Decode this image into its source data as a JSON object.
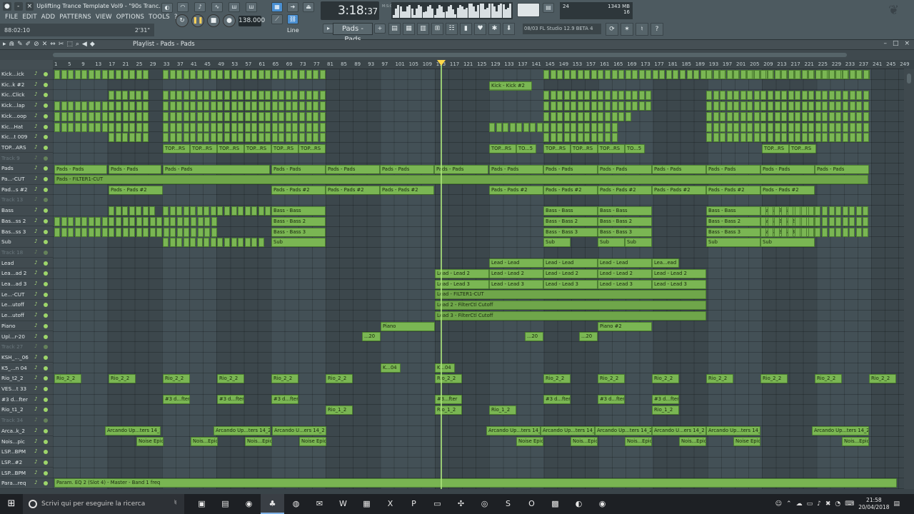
{
  "window": {
    "title": "Uplifting Trance Template Vol9 - \"90s Tranc..",
    "hint_left": "88:02:10",
    "hint_right": "2'31\""
  },
  "menu": [
    "FILE",
    "EDIT",
    "ADD",
    "PATTERNS",
    "VIEW",
    "OPTIONS",
    "TOOLS",
    "?"
  ],
  "transport": {
    "tempo": "138.000",
    "time_main": "3:18",
    "time_sub": "37",
    "time_unit": "M:S:CS",
    "snap": "Line",
    "pattern": "Pads - Pads"
  },
  "monitor": {
    "cpu": "24",
    "mem": "1343 MB",
    "poly": "16"
  },
  "news": "08/03  FL Studio 12.9 BETA 4",
  "playlist": {
    "title": "Playlist - Pads - Pads",
    "ruler_ticks": [
      "1",
      "5",
      "9",
      "13",
      "17",
      "21",
      "25",
      "29",
      "33",
      "37",
      "41",
      "45",
      "49",
      "53",
      "57",
      "61",
      "65",
      "69",
      "73",
      "77",
      "81",
      "85",
      "89",
      "93",
      "97",
      "101",
      "105",
      "109",
      "113",
      "117",
      "121",
      "125",
      "129",
      "133",
      "137",
      "141",
      "145",
      "149",
      "153",
      "157",
      "161",
      "165",
      "169",
      "173",
      "177",
      "181",
      "185",
      "189",
      "193",
      "197",
      "201",
      "205",
      "209",
      "213",
      "217",
      "221",
      "225",
      "229",
      "233",
      "237",
      "241",
      "245",
      "249"
    ]
  },
  "tracks": [
    {
      "name": "Kick...ick",
      "dim": false
    },
    {
      "name": "Kic..k #2",
      "dim": false
    },
    {
      "name": "Kic..Click",
      "dim": false
    },
    {
      "name": "Kick...lap",
      "dim": false
    },
    {
      "name": "Kick...oop",
      "dim": false
    },
    {
      "name": "Kic...Hat",
      "dim": false
    },
    {
      "name": "Kic...t 009",
      "dim": false
    },
    {
      "name": "TOP...ARS",
      "dim": false
    },
    {
      "name": "Track 9",
      "dim": true
    },
    {
      "name": "Pads",
      "dim": false
    },
    {
      "name": "Pa...-CUT",
      "dim": false
    },
    {
      "name": "Pad...s #2",
      "dim": false
    },
    {
      "name": "Track 13",
      "dim": true
    },
    {
      "name": "Bass",
      "dim": false
    },
    {
      "name": "Bas...ss 2",
      "dim": false
    },
    {
      "name": "Bas...ss 3",
      "dim": false
    },
    {
      "name": "Sub",
      "dim": false
    },
    {
      "name": "Track 18",
      "dim": true
    },
    {
      "name": "Lead",
      "dim": false
    },
    {
      "name": "Lea...ad 2",
      "dim": false
    },
    {
      "name": "Lea...ad 3",
      "dim": false
    },
    {
      "name": "Le...-CUT",
      "dim": false
    },
    {
      "name": "Le...utoff",
      "dim": false
    },
    {
      "name": "Le...utoff",
      "dim": false
    },
    {
      "name": "Piano",
      "dim": false
    },
    {
      "name": "Upl...r-20",
      "dim": false
    },
    {
      "name": "Track 27",
      "dim": true
    },
    {
      "name": "KSH_..._06",
      "dim": false
    },
    {
      "name": "K5_...n 04",
      "dim": false
    },
    {
      "name": "Rio_t2_2",
      "dim": false
    },
    {
      "name": "VES...t 33",
      "dim": false
    },
    {
      "name": "#3 d...fter",
      "dim": false
    },
    {
      "name": "Rio_t1_2",
      "dim": false
    },
    {
      "name": "Track 34",
      "dim": true
    },
    {
      "name": "Arca..k_2",
      "dim": false
    },
    {
      "name": "Nois...pic",
      "dim": false
    },
    {
      "name": "LSP...BPM",
      "dim": false
    },
    {
      "name": "LSP...#2",
      "dim": false
    },
    {
      "name": "LSP...BPM",
      "dim": false
    },
    {
      "name": "Para...req",
      "dim": false
    }
  ],
  "clips": {
    "kick2": "Kick - Kick #2",
    "top": "TOP...RS",
    "top2": "TO...5",
    "pads": "Pads - Pads",
    "pads_cut": "Pads - FILTER1-CUT",
    "pads2": "Pads - Pads #2",
    "bass": "Bass - Bass",
    "bass2": "Bass - Bass 2",
    "bass3": "Bass - Bass 3",
    "sub": "Sub",
    "lead": "Lead - Lead",
    "lead_end": "Lea...ead",
    "lead2": "Lead - Lead 2",
    "lead3": "Lead - Lead 3",
    "lead_cut": "Lead - FILTER1-CUT",
    "lead2_cut": "Lead 2 - FilterCtl Cutoff",
    "lead3_cut": "Lead 3 - FilterCtl Cutoff",
    "piano": "Piano",
    "piano2": "Piano #2",
    "upl": "...20",
    "k04": "K...04",
    "rio2": "Rio_2_2",
    "fter": "#3 d...fter",
    "fter2": "#3...fter",
    "rio1": "Rio_1_2",
    "arcando": "Arcando Up...ters 14_2",
    "arcando2": "Arcando U...ers 14_2",
    "noise": "Noise Epic",
    "noise2": "Nois...Epic",
    "param": "Param. EQ 2 (Slot 4) - Master - Band 1 freq"
  },
  "taskbar": {
    "search_placeholder": "Scrivi qui per eseguire la ricerca",
    "time": "21:58",
    "date": "20/04/2018"
  },
  "colors": {
    "clip": "#7ab653",
    "background": "#3a4449",
    "playhead": "#ffd84a"
  }
}
